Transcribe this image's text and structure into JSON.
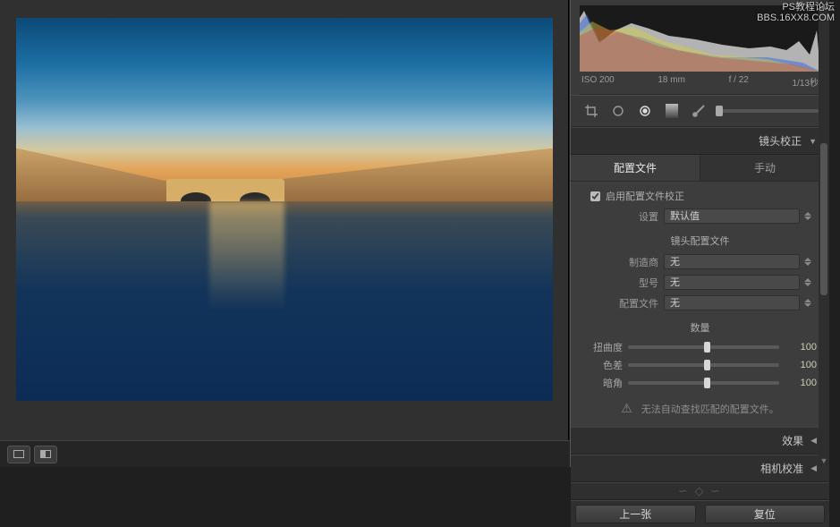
{
  "watermark": {
    "line1": "PS教程论坛",
    "line2": "BBS.16XX8.COM"
  },
  "histogram": {
    "meta": {
      "iso": "ISO 200",
      "focal": "18 mm",
      "aperture": "f / 22",
      "shutter": "1/13秒"
    }
  },
  "toolstrip": {
    "tools": [
      "crop-icon",
      "spot-icon",
      "redeye-icon",
      "grad-icon",
      "brush-icon"
    ]
  },
  "panels": {
    "lens": {
      "title": "镜头校正",
      "expanded": true
    },
    "effects": {
      "title": "效果",
      "expanded": false
    },
    "camera": {
      "title": "相机校准",
      "expanded": false
    }
  },
  "lens": {
    "tabs": {
      "profile": "配置文件",
      "manual": "手动",
      "active": "profile"
    },
    "enable": {
      "label": "启用配置文件校正",
      "checked": true
    },
    "setup": {
      "label": "设置",
      "value": "默认值"
    },
    "section_profile": "镜头配置文件",
    "maker": {
      "label": "制造商",
      "value": "无"
    },
    "model": {
      "label": "型号",
      "value": "无"
    },
    "profile": {
      "label": "配置文件",
      "value": "无"
    },
    "section_amount": "数量",
    "sliders": {
      "distortion": {
        "label": "扭曲度",
        "value": 100
      },
      "ca": {
        "label": "色差",
        "value": 100
      },
      "vignette": {
        "label": "暗角",
        "value": 100
      }
    },
    "warning": "无法自动查找匹配的配置文件。"
  },
  "footer": {
    "prev": "上一张",
    "reset": "复位"
  }
}
